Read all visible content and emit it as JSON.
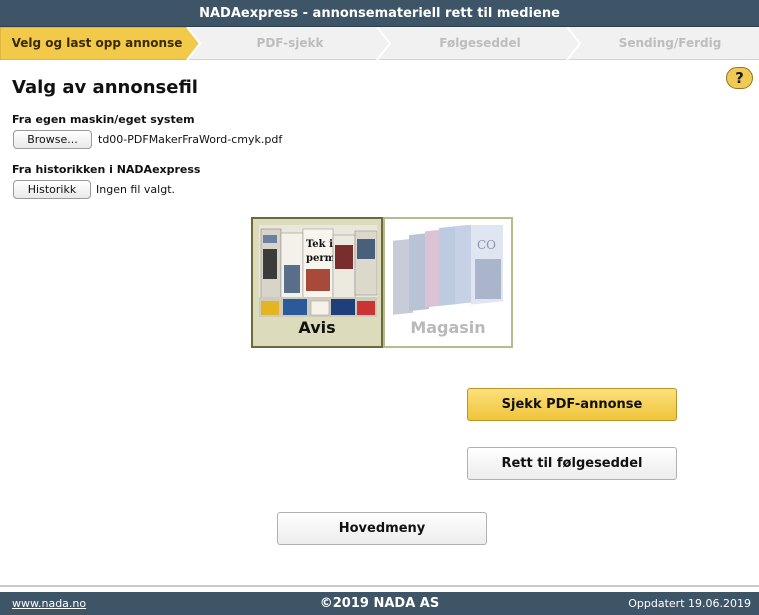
{
  "header": {
    "title": "NADAexpress - annonsemateriell rett til mediene"
  },
  "steps": [
    {
      "label": "Velg og last opp annonse",
      "active": true
    },
    {
      "label": "PDF-sjekk",
      "active": false
    },
    {
      "label": "Følgeseddel",
      "active": false
    },
    {
      "label": "Sending/Ferdig",
      "active": false
    }
  ],
  "help": {
    "label": "?"
  },
  "main": {
    "title": "Valg av annonsefil",
    "own_system": {
      "label": "Fra egen maskin/eget system",
      "button": "Browse...",
      "filename": "td00-PDFMakerFraWord-cmyk.pdf"
    },
    "history": {
      "label": "Fra historikken i NADAexpress",
      "button": "Historikk",
      "filename": "Ingen fil valgt."
    },
    "media": [
      {
        "label": "Avis",
        "selected": true
      },
      {
        "label": "Magasin",
        "selected": false
      }
    ],
    "buttons": {
      "check_pdf": "Sjekk PDF-annonse",
      "go_to_slip": "Rett til følgeseddel",
      "main_menu": "Hovedmeny"
    }
  },
  "footer": {
    "link": "www.nada.no",
    "copyright": "©2019 NADA AS",
    "updated": "Oppdatert 19.06.2019"
  },
  "colors": {
    "header_bg": "#3d5566",
    "active_step": "#f3c94a",
    "primary_button": "#f0c43b",
    "selected_tile": "#dcdbbb"
  }
}
